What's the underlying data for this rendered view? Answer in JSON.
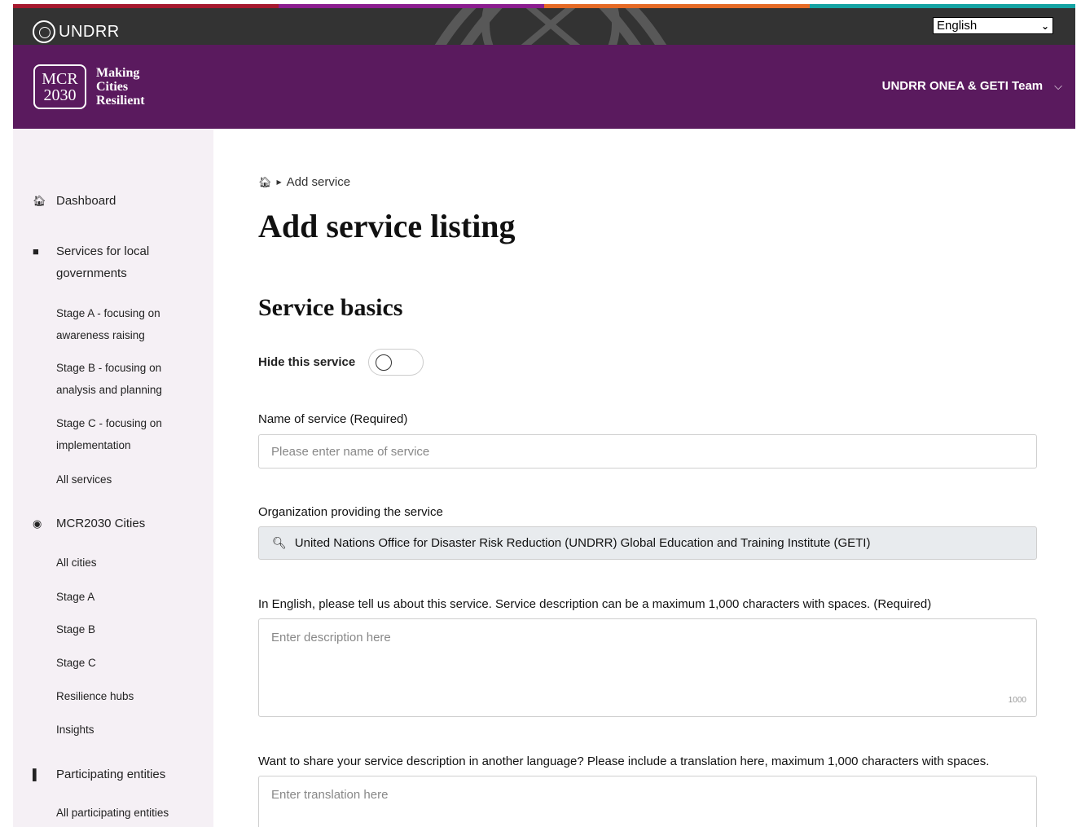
{
  "stripe_colors": [
    "#a6192e",
    "#8b1d8f",
    "#e56a25",
    "#13a3a3"
  ],
  "topbar": {
    "logo_text": "UNDRR",
    "language": "English"
  },
  "header": {
    "mcr_line1": "MCR",
    "mcr_line2": "2030",
    "tagline1": "Making",
    "tagline2": "Cities",
    "tagline3": "Resilient",
    "team": "UNDRR ONEA & GETI Team"
  },
  "sidebar": {
    "dashboard": "Dashboard",
    "services": "Services for local governments",
    "stage_a": "Stage A - focusing on awareness raising",
    "stage_b": "Stage B - focusing on analysis and planning",
    "stage_c": "Stage C - focusing on implementation",
    "all_services": "All services",
    "cities": "MCR2030 Cities",
    "all_cities": "All cities",
    "city_stage_a": "Stage A",
    "city_stage_b": "Stage B",
    "city_stage_c": "Stage C",
    "resilience_hubs": "Resilience hubs",
    "insights": "Insights",
    "entities": "Participating entities",
    "all_entities": "All participating entities"
  },
  "main": {
    "breadcrumb_current": "Add service",
    "title": "Add service listing",
    "section_title": "Service basics",
    "hide_label": "Hide this service",
    "name_label": "Name of service (Required)",
    "name_placeholder": "Please enter name of service",
    "org_label": "Organization providing the service",
    "org_value": "United Nations Office for Disaster Risk Reduction (UNDRR) Global Education and Training Institute (GETI)",
    "desc_label": "In English, please tell us about this service. Service description can be a maximum 1,000 characters with spaces. (Required)",
    "desc_placeholder": "Enter description here",
    "desc_counter": "1000",
    "translation_label": "Want to share your service description in another language? Please include a translation here, maximum 1,000 characters with spaces.",
    "translation_placeholder": "Enter translation here"
  }
}
